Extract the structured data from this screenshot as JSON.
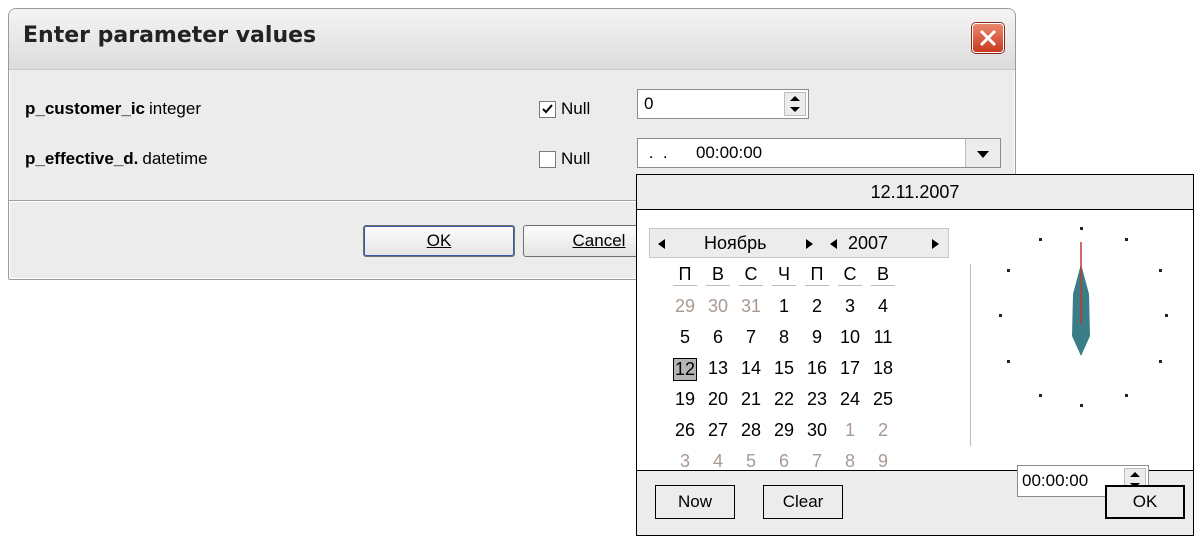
{
  "dialog": {
    "title": "Enter parameter values",
    "params": [
      {
        "name": "p_customer_ic",
        "type": "integer",
        "null_label": "Null",
        "null_checked": true,
        "value": "0"
      },
      {
        "name": "p_effective_d.",
        "type": "datetime",
        "null_label": "Null",
        "null_checked": false,
        "value": " .  .      00:00:00"
      }
    ],
    "ok_label": "OK",
    "cancel_label": "Cancel"
  },
  "popup": {
    "header_date": "12.11.2007",
    "month": "Ноябрь",
    "year": "2007",
    "weekdays": [
      "П",
      "В",
      "С",
      "Ч",
      "П",
      "С",
      "В"
    ],
    "weeks": [
      [
        "29",
        "30",
        "31",
        "1",
        "2",
        "3",
        "4"
      ],
      [
        "5",
        "6",
        "7",
        "8",
        "9",
        "10",
        "11"
      ],
      [
        "12",
        "13",
        "14",
        "15",
        "16",
        "17",
        "18"
      ],
      [
        "19",
        "20",
        "21",
        "22",
        "23",
        "24",
        "25"
      ],
      [
        "26",
        "27",
        "28",
        "29",
        "30",
        "1",
        "2"
      ],
      [
        "3",
        "4",
        "5",
        "6",
        "7",
        "8",
        "9"
      ]
    ],
    "selected_day": "12",
    "time_value": "00:00:00",
    "now_label": "Now",
    "clear_label": "Clear",
    "ok_label": "OK"
  },
  "colors": {
    "accent": "#3a57a8",
    "close": "#c9391f",
    "clock_hand": "#3b7d86",
    "gray_day": "#a89a92"
  }
}
